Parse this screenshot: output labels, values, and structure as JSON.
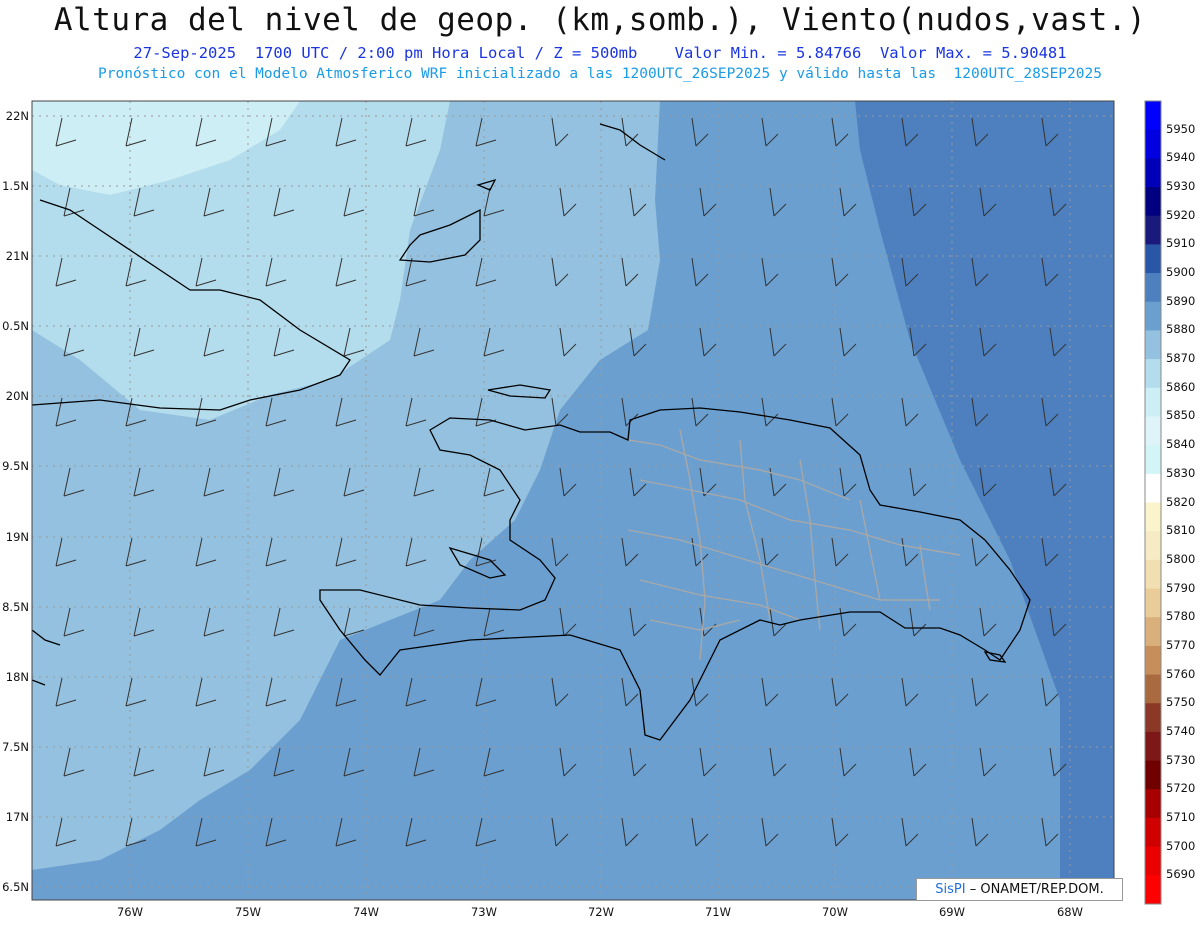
{
  "header": {
    "title": "Altura del nivel de geop. (km,somb.), Viento(nudos,vast.)",
    "subtitle": "27-Sep-2025  1700 UTC / 2:00 pm Hora Local / Z = 500mb    Valor Min. = 5.84766  Valor Max. = 5.90481",
    "model_line": "Pronóstico con el Modelo Atmosferico WRF inicializado a las 1200UTC_26SEP2025 y válido hasta las  1200UTC_28SEP2025"
  },
  "map": {
    "lat_labels": [
      "22N",
      "1.5N",
      "21N",
      "0.5N",
      "20N",
      "9.5N",
      "19N",
      "8.5N",
      "18N",
      "7.5N",
      "17N",
      "6.5N"
    ],
    "lon_labels": [
      "76W",
      "75W",
      "74W",
      "73W",
      "72W",
      "71W",
      "70W",
      "69W",
      "68W"
    ],
    "colors": {
      "band_5860": "#cdeef5",
      "band_5870": "#b3dcec",
      "band_5880": "#93c1df",
      "band_5890": "#6a9fd0",
      "band_5900": "#4e80bf",
      "coast": "#000000",
      "provinces": "#a8a8a8",
      "barbs": "#333333"
    }
  },
  "colorbar": {
    "levels": [
      "5950",
      "5940",
      "5930",
      "5920",
      "5910",
      "5900",
      "5890",
      "5880",
      "5870",
      "5860",
      "5850",
      "5840",
      "5830",
      "5820",
      "5810",
      "5800",
      "5790",
      "5780",
      "5770",
      "5760",
      "5750",
      "5740",
      "5730",
      "5720",
      "5710",
      "5700",
      "5690"
    ],
    "colors": [
      "#0000ff",
      "#0000e0",
      "#0000b8",
      "#000080",
      "#1a1a7c",
      "#2a56a8",
      "#4e80bf",
      "#6a9fd0",
      "#93c1df",
      "#b3dcec",
      "#cdeef5",
      "#dff4f8",
      "#d2f5f8",
      "#ffffff",
      "#fbf3cc",
      "#f6ebc4",
      "#f1dfb2",
      "#e9cc98",
      "#d9b07c",
      "#c68e5a",
      "#aa6a40",
      "#8c3826",
      "#7e1818",
      "#700000",
      "#a80000",
      "#d00000",
      "#ea0000",
      "#ff0000"
    ]
  },
  "credit": {
    "brand": "SisPI",
    "org": "– ONAMET/REP.DOM."
  }
}
